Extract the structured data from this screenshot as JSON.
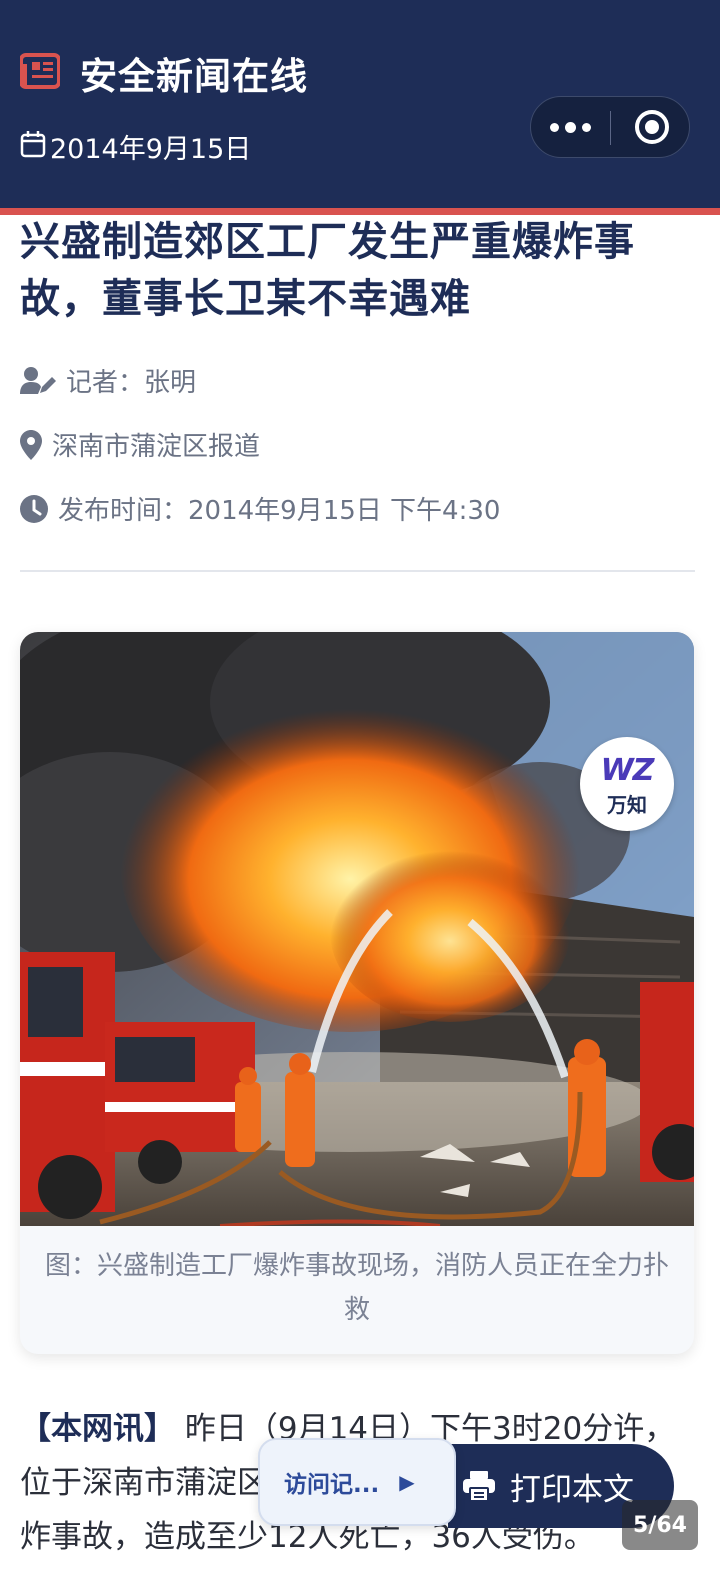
{
  "header": {
    "site_title": "安全新闻在线",
    "date": "2014年9月15日",
    "icons": {
      "site": "newspaper-icon",
      "date": "calendar-icon",
      "more": "more-dots-icon",
      "close": "capsule-close-icon"
    },
    "colors": {
      "bar": "#1e2d57",
      "stripe": "#d9534f"
    }
  },
  "article": {
    "headline": "兴盛制造郊区工厂发生严重爆炸事故，董事长卫某不幸遇难",
    "reporter": "记者：张明",
    "location": "深南市蒲淀区报道",
    "publish_time": "发布时间：2014年9月15日 下午4:30",
    "caption": "图：兴盛制造工厂爆炸事故现场，消防人员正在全力扑救",
    "lead_label": "【本网讯】",
    "lead_text": " 昨日（9月14日）下午3时20分许，位于深南市蒲淀区兴盛制造郊区工厂发生特大爆炸事故，造成至少12人死亡，36人受伤。"
  },
  "watermark": {
    "logo": "WZ",
    "text": "万知"
  },
  "floating": {
    "visit_label": "访问记...",
    "visit_arrow": "▶",
    "print_label": "打印本文",
    "page_indicator": "5/64"
  }
}
